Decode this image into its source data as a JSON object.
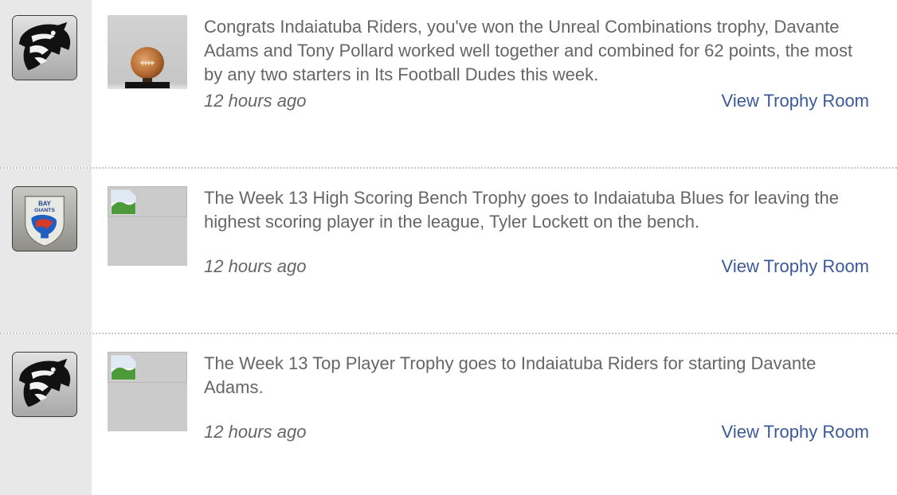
{
  "feed": {
    "items": [
      {
        "message": "Congrats Indaiatuba Riders, you've won the Unreal Combinations trophy, Davante Adams and Tony Pollard worked well together and combined for 62 points, the most by any two starters in Its Football Dudes this week.",
        "time": "12 hours ago",
        "link": "View Trophy Room",
        "avatar_icon": "panther-logo",
        "trophy_icon": "football-trophy"
      },
      {
        "message": "The Week 13 High Scoring Bench Trophy goes to Indaiatuba Blues for leaving the highest scoring player in the league, Tyler Lockett on the bench.",
        "time": "12 hours ago",
        "link": "View Trophy Room",
        "avatar_icon": "team-crest-logo",
        "trophy_icon": "broken-image"
      },
      {
        "message": "The Week 13 Top Player Trophy goes to Indaiatuba Riders for starting Davante Adams.",
        "time": "12 hours ago",
        "link": "View Trophy Room",
        "avatar_icon": "panther-logo",
        "trophy_icon": "broken-image"
      }
    ]
  },
  "colors": {
    "text": "#666666",
    "link": "#3b5998",
    "sidebar": "#e8e8e8",
    "placeholder": "#cbcbcb"
  }
}
